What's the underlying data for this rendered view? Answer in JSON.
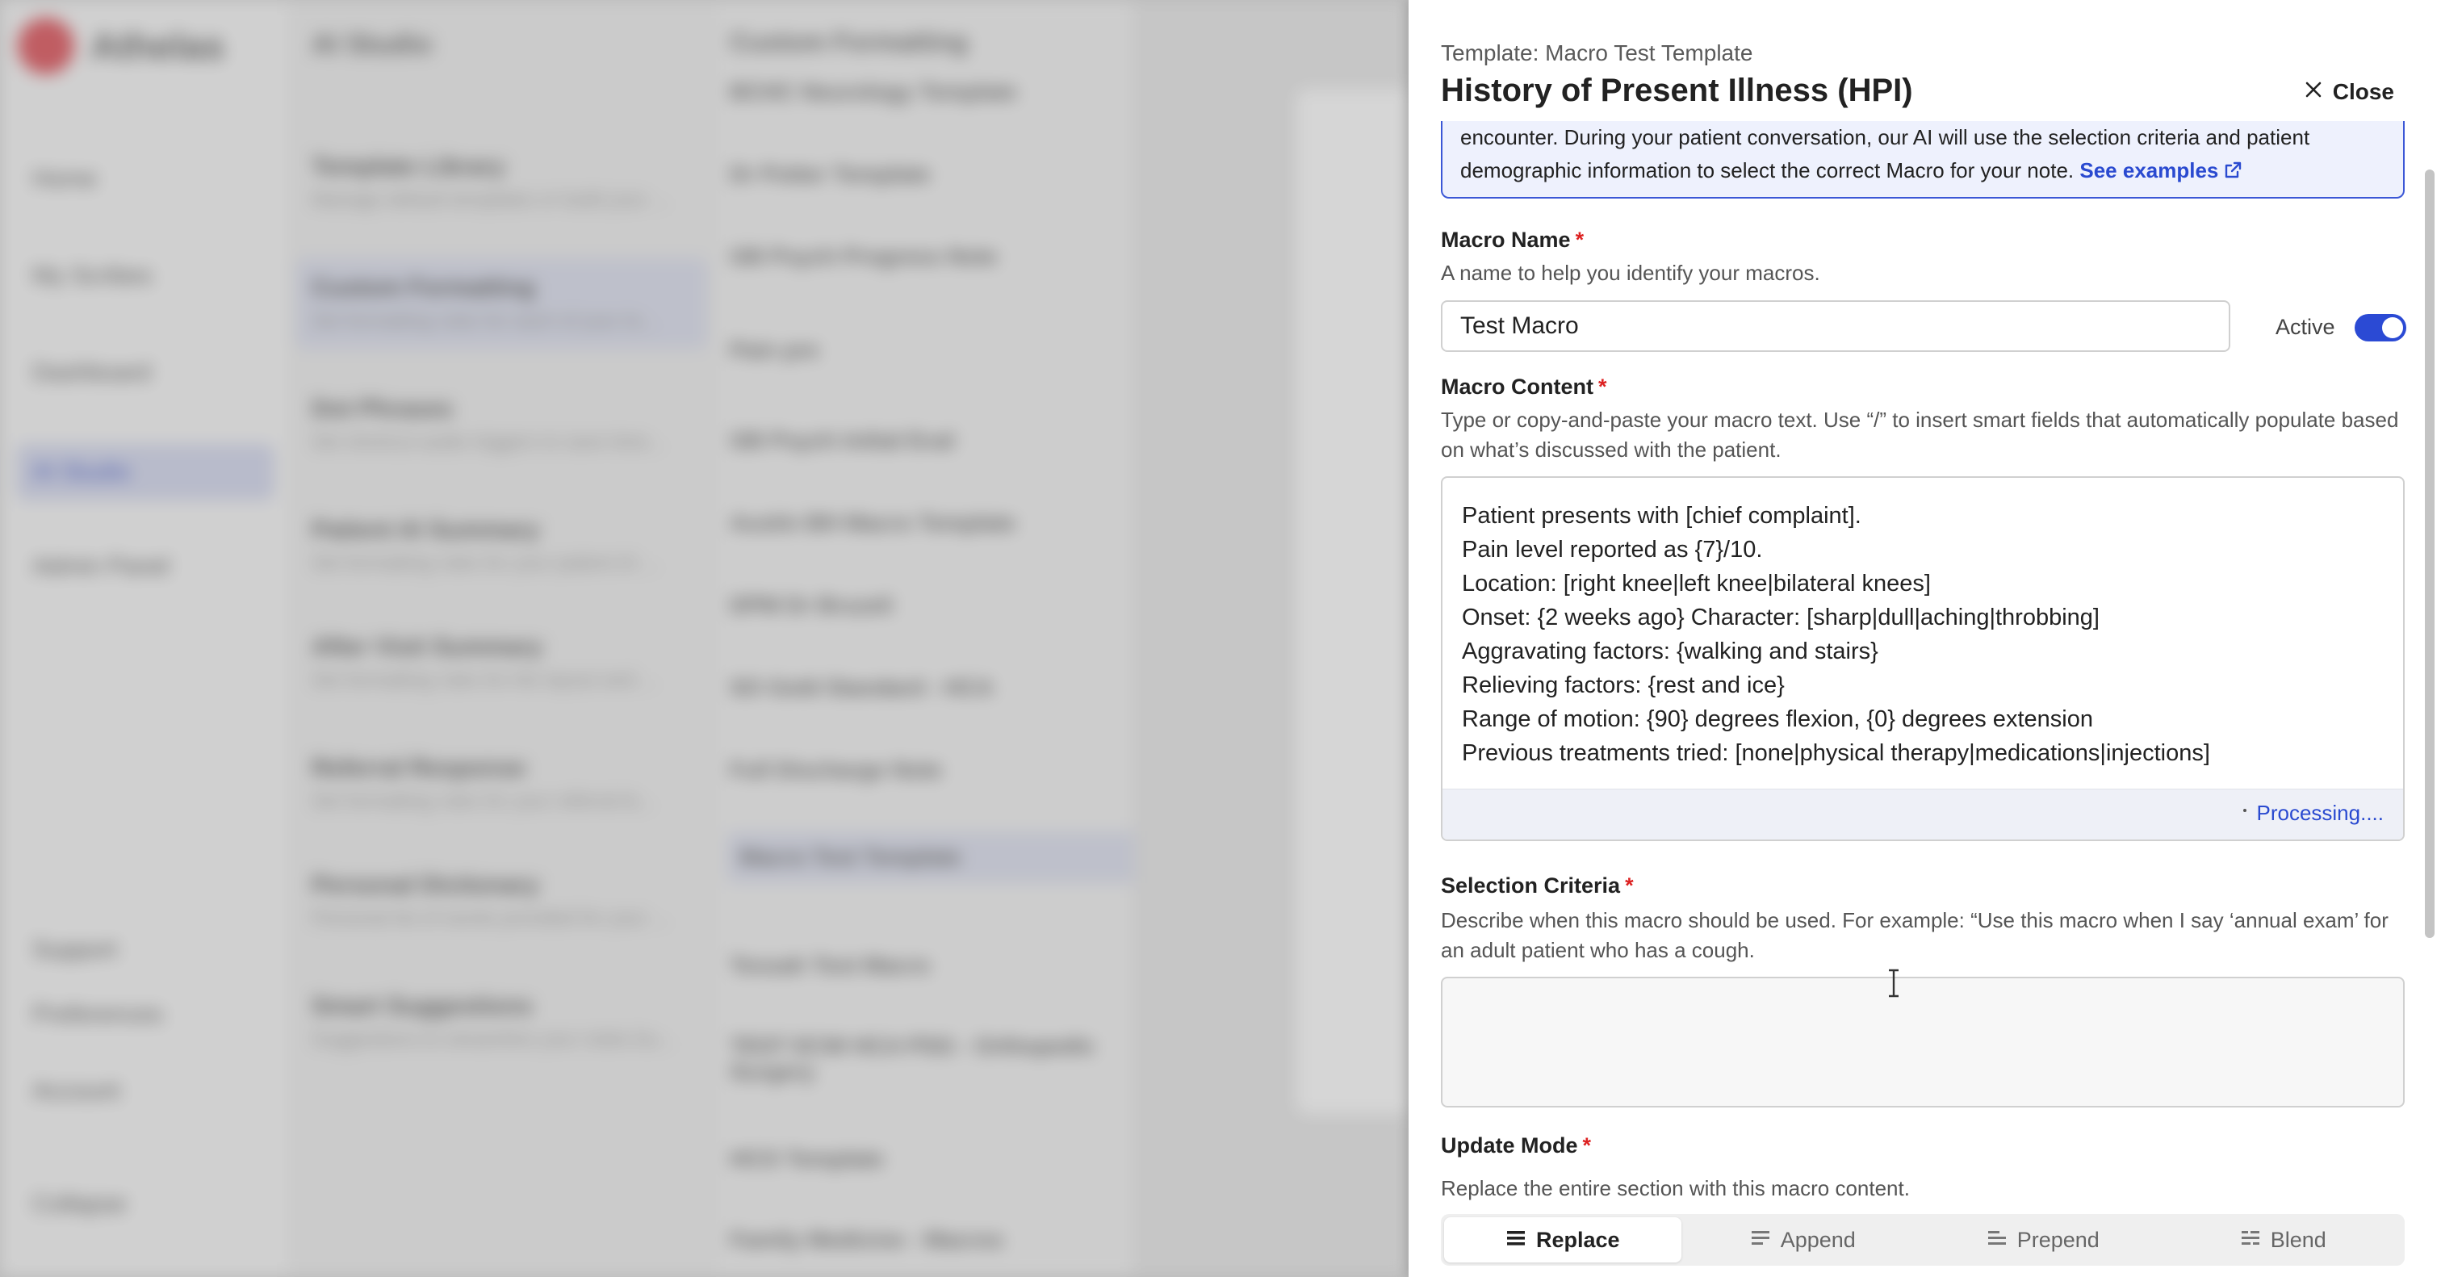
{
  "background": {
    "logo_text": "Athelas",
    "nav": [
      "Home",
      "My Scribes",
      "Dashboard",
      "AI Studio",
      "Admin Panel"
    ],
    "nav_bottom": [
      "Support",
      "Preferences",
      "Account",
      "Collapse"
    ],
    "studio_title": "AI Studio",
    "studio_cards": [
      {
        "title": "Template Library",
        "sub": "Manage default templates or build your ..."
      },
      {
        "title": "Custom Formatting",
        "sub": "Set formatting rules for each of your te..."
      },
      {
        "title": "Dot Phrases",
        "sub": "Set shortcut audio triggers to save time..."
      },
      {
        "title": "Patient AI Summary",
        "sub": "Set formatting rules for your patient AI ..."
      },
      {
        "title": "After Visit Summary",
        "sub": "Set formatting rules for the layout and ..."
      },
      {
        "title": "Referral Response",
        "sub": "Set formatting rules for your referral le..."
      },
      {
        "title": "Personal Dictionary",
        "sub": "Personal list of words provided for your ..."
      },
      {
        "title": "Smart Suggestions",
        "sub": "Suggestions to streamline your notes bu..."
      }
    ],
    "list_title": "Custom Formatting",
    "list_items": [
      "BCHC Neurology Template",
      "Dr Potter Template",
      "GB Psych Progress Note",
      "Pain pre",
      "GB Psych Initial Eval",
      "Austin BH Macro Template",
      "DPM Dr Bruzeli",
      "SO Gold Standard - HCA",
      "Full Discharge Note",
      "Macro Test Template",
      "Tessah Test Macro",
      "TEST ECW HCA PSG - Orthopedic Surgery",
      "HCO Template",
      "Family Medicine - Macros"
    ]
  },
  "drawer": {
    "template_label": "Template: Macro Test Template",
    "title": "History of Present Illness (HPI)",
    "close_label": "Close",
    "info_text_line1": "encounter. During your patient conversation, our AI will use the selection criteria and patient",
    "info_text_line2": "demographic information to select the correct Macro for your note.",
    "info_link": "See examples",
    "macro_name": {
      "label": "Macro Name",
      "required": "*",
      "help": "A name to help you identify your macros.",
      "value": "Test Macro"
    },
    "active_label": "Active",
    "active_state": "on",
    "macro_content": {
      "label": "Macro Content",
      "required": "*",
      "help": "Type or copy-and-paste your macro text. Use “/” to insert smart fields that automatically populate based on what’s discussed with the patient.",
      "lines": [
        "Patient presents with [chief complaint].",
        "Pain level reported as {7}/10.",
        "Location: [right knee|left knee|bilateral knees]",
        "Onset: {2 weeks ago} Character: [sharp|dull|aching|throbbing]",
        "Aggravating factors: {walking and stairs}",
        "Relieving factors: {rest and ice}",
        "Range of motion: {90} degrees flexion, {0} degrees extension",
        "Previous treatments tried: [none|physical therapy|medications|injections]"
      ],
      "status": "Processing...."
    },
    "selection_criteria": {
      "label": "Selection Criteria",
      "required": "*",
      "help": "Describe when this macro should be used. For example: “Use this macro when I say ‘annual exam’ for an adult patient who has a cough.",
      "value": ""
    },
    "update_mode": {
      "label": "Update Mode",
      "required": "*",
      "help": "Replace the entire section with this macro content.",
      "options": [
        "Replace",
        "Append",
        "Prepend",
        "Blend"
      ],
      "selected": "Replace"
    }
  },
  "colors": {
    "accent": "#2b4ad4",
    "required": "#dd2222",
    "info_bg": "#eef1fd"
  }
}
